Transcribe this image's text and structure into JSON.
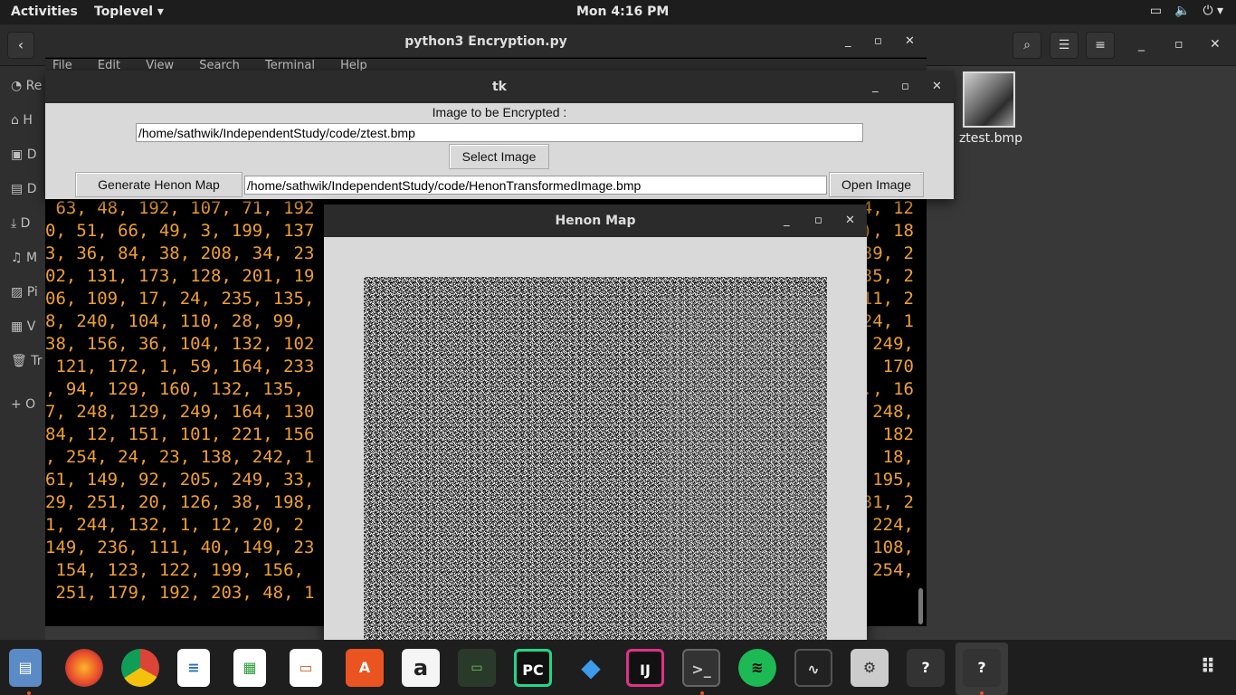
{
  "topbar": {
    "activities": "Activities",
    "app_menu": "Toplevel ▾",
    "clock": "Mon  4:16 PM",
    "tray": [
      "screen-icon",
      "volume-icon",
      "power-icon"
    ]
  },
  "file_manager": {
    "sidebar": [
      "Re",
      "H",
      "D",
      "D",
      "D",
      "M",
      "Pi",
      "V",
      "Tr",
      "+ O"
    ],
    "file_label": "ztest.bmp"
  },
  "terminal": {
    "title": "python3 Encryption.py",
    "menu": [
      "File",
      "Edit",
      "View",
      "Search",
      "Terminal",
      "Help"
    ],
    "lines": [
      " 63, 48, 192, 107, 71, 192",
      "0, 51, 66, 49, 3, 199, 137",
      "3, 36, 84, 38, 208, 34, 23",
      "02, 131, 173, 128, 201, 19",
      "06, 109, 17, 24, 235, 135,",
      "8, 240, 104, 110, 28, 99,",
      "38, 156, 36, 104, 132, 102",
      " 121, 172, 1, 59, 164, 233",
      ", 94, 129, 160, 132, 135,",
      "7, 248, 129, 249, 164, 130",
      "84, 12, 151, 101, 221, 156",
      ", 254, 24, 23, 138, 242, 1",
      "61, 149, 92, 205, 249, 33,",
      "29, 251, 20, 126, 38, 198,",
      "1, 244, 132, 1, 12, 20, 2",
      "149, 236, 111, 40, 149, 23",
      " 154, 123, 122, 199, 156,",
      " 251, 179, 192, 203, 48, 1"
    ],
    "lines_right": [
      "4, 12",
      "), 18",
      "39, 2",
      "35, 2",
      "11, 2",
      "24, 1",
      "249,",
      "170",
      "., 16",
      "248,",
      "182",
      "18,",
      "195,",
      "31, 2",
      "224,",
      "108,",
      "254,",
      ""
    ]
  },
  "tk": {
    "title": "tk",
    "label": "Image to be Encrypted :",
    "source_path": "/home/sathwik/IndependentStudy/code/ztest.bmp",
    "select_button": "Select Image",
    "henon_button": "Generate Henon Map",
    "output_path": "/home/sathwik/IndependentStudy/code/HenonTransformedImage.bmp",
    "open_button": "Open Image"
  },
  "henon": {
    "title": "Henon Map"
  },
  "dock": {
    "apps": [
      "files-icon",
      "firefox-icon",
      "chrome-icon",
      "writer-icon",
      "calc-icon",
      "impress-icon",
      "software-icon",
      "amazon-icon",
      "battery-icon",
      "pycharm-icon",
      "vscode-icon",
      "intellij-icon",
      "terminal-icon",
      "spotify-icon",
      "system-monitor-icon",
      "mixer-icon",
      "toplevel-icon",
      "toplevel-active-icon",
      "app-grid-icon"
    ],
    "labels": {
      "pycharm": "PC",
      "intellij": "IJ",
      "software": "A",
      "amazon": "a"
    },
    "colors": {
      "accent": "#e95420",
      "terminal_text": "#f0a030"
    }
  }
}
